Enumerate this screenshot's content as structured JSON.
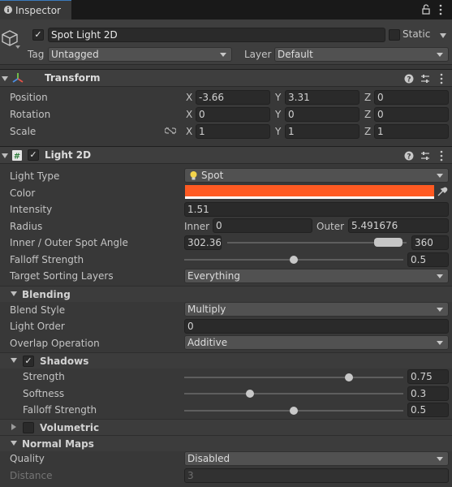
{
  "window": {
    "tab_title": "Inspector"
  },
  "gameobject": {
    "active": true,
    "name": "Spot Light 2D",
    "static_label": "Static",
    "tag_label": "Tag",
    "tag_value": "Untagged",
    "layer_label": "Layer",
    "layer_value": "Default"
  },
  "transform": {
    "title": "Transform",
    "position": {
      "label": "Position",
      "x": "-3.66",
      "y": "3.31",
      "z": "0"
    },
    "rotation": {
      "label": "Rotation",
      "x": "0",
      "y": "0",
      "z": "0"
    },
    "scale": {
      "label": "Scale",
      "x": "1",
      "y": "1",
      "z": "1"
    }
  },
  "light2d": {
    "title": "Light 2D",
    "enabled": true,
    "light_type": {
      "label": "Light Type",
      "value": "Spot"
    },
    "color": {
      "label": "Color",
      "hex": "#ff5a22"
    },
    "intensity": {
      "label": "Intensity",
      "value": "1.51"
    },
    "radius": {
      "label": "Radius",
      "inner_label": "Inner",
      "inner": "0",
      "outer_label": "Outer",
      "outer": "5.491676"
    },
    "spot_angle": {
      "label": "Inner / Outer Spot Angle",
      "inner": "302.36",
      "outer": "360",
      "inner_fraction": 0.84,
      "outer_fraction": 1.0
    },
    "falloff": {
      "label": "Falloff Strength",
      "value": "0.5",
      "fraction": 0.5
    },
    "sorting_layers": {
      "label": "Target Sorting Layers",
      "value": "Everything"
    },
    "blending": {
      "title": "Blending",
      "blend_style": {
        "label": "Blend Style",
        "value": "Multiply"
      },
      "light_order": {
        "label": "Light Order",
        "value": "0"
      },
      "overlap": {
        "label": "Overlap Operation",
        "value": "Additive"
      }
    },
    "shadows": {
      "title": "Shadows",
      "enabled": true,
      "strength": {
        "label": "Strength",
        "value": "0.75",
        "fraction": 0.75
      },
      "softness": {
        "label": "Softness",
        "value": "0.3",
        "fraction": 0.3
      },
      "falloff": {
        "label": "Falloff Strength",
        "value": "0.5",
        "fraction": 0.5
      }
    },
    "volumetric": {
      "title": "Volumetric",
      "enabled": false
    },
    "normal_maps": {
      "title": "Normal Maps",
      "quality": {
        "label": "Quality",
        "value": "Disabled"
      },
      "distance": {
        "label": "Distance",
        "value": "3"
      }
    }
  },
  "icons": [
    "info-icon",
    "lock-icon",
    "kebab-menu-icon",
    "cube-icon",
    "transform-axes-icon",
    "help-icon",
    "presets-icon",
    "light2d-script-icon",
    "lightbulb-icon",
    "eyedropper-icon",
    "scale-link-icon"
  ],
  "colors": {
    "accent": "#3a79bb",
    "panel": "#383838",
    "header": "#3e3e3e",
    "field": "#2a2a2a"
  }
}
